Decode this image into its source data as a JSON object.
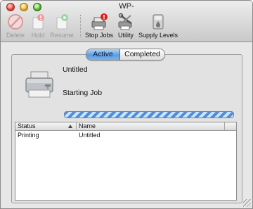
{
  "window": {
    "title": "WP-"
  },
  "toolbar": {
    "items": [
      {
        "label": "Delete",
        "icon": "delete-icon",
        "enabled": false
      },
      {
        "label": "Hold",
        "icon": "hold-icon",
        "enabled": false
      },
      {
        "label": "Resume",
        "icon": "resume-icon",
        "enabled": false
      },
      {
        "label": "Stop Jobs",
        "icon": "stop-jobs-icon",
        "enabled": true
      },
      {
        "label": "Utility",
        "icon": "utility-icon",
        "enabled": true
      },
      {
        "label": "Supply Levels",
        "icon": "supply-levels-icon",
        "enabled": true
      }
    ]
  },
  "tabs": {
    "active": "Active",
    "completed": "Completed",
    "selected": "Active"
  },
  "job": {
    "name": "Untitled",
    "status": "Starting Job"
  },
  "table": {
    "columns": [
      "Status",
      "Name"
    ],
    "sort_column": "Status",
    "sort_direction": "ascending",
    "rows": [
      {
        "status": "Printing",
        "name": "Untitled"
      }
    ]
  },
  "colors": {
    "accent": "#5c9ce2",
    "progress": "#4e8fdc"
  }
}
